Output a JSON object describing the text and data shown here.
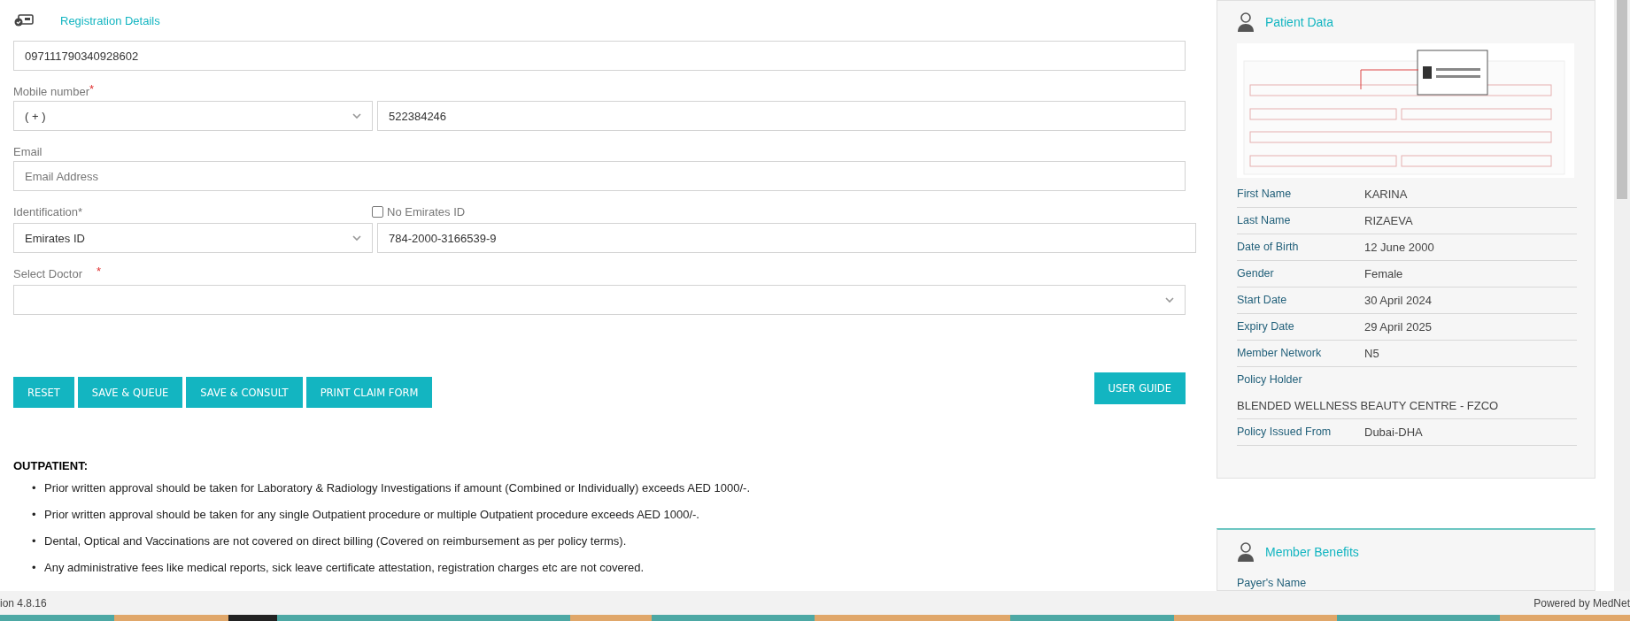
{
  "registration": {
    "title": "Registration Details",
    "card_number": {
      "value": "097111790340928602"
    },
    "mobile": {
      "label": "Mobile number",
      "required_mark": "*",
      "country_code": "( + )",
      "number": "522384246"
    },
    "email": {
      "label": "Email",
      "placeholder": "Email Address"
    },
    "identification": {
      "label": "Identification*",
      "no_id": {
        "label": "No Emirates ID",
        "checked": false
      },
      "type": "Emirates ID",
      "number": "784-2000-3166539-9"
    },
    "doctor": {
      "label": "Select Doctor",
      "required_mark": "*"
    }
  },
  "buttons": [
    {
      "label": "RESET"
    },
    {
      "label": "SAVE & QUEUE"
    },
    {
      "label": "SAVE & CONSULT"
    },
    {
      "label": "PRINT CLAIM FORM"
    }
  ],
  "user_guide": {
    "label": "USER GUIDE"
  },
  "notes": {
    "title": "OUTPATIENT:",
    "items": [
      {
        "marker": "•",
        "text": "Prior written approval should be taken for Laboratory & Radiology Investigations if amount (Combined or Individually) exceeds AED 1000/-."
      },
      {
        "marker": "•",
        "text": "Prior written approval should be taken for any single Outpatient procedure or multiple Outpatient procedure exceeds AED 1000/-."
      },
      {
        "marker": "•",
        "text": "Dental, Optical and Vaccinations are not covered on direct billing (Covered on reimbursement as per policy terms)."
      },
      {
        "marker": "•",
        "text": "Any administrative fees like medical reports, sick leave certificate attestation, registration charges etc are not covered."
      }
    ]
  },
  "patient_data": {
    "title": "Patient Data",
    "fields": [
      {
        "label": "First Name",
        "value": "KARINA"
      },
      {
        "label": "Last Name",
        "value": "RIZAEVA"
      },
      {
        "label": "Date of Birth",
        "value": "12 June 2000"
      },
      {
        "label": "Gender",
        "value": "Female"
      },
      {
        "label": "Start Date",
        "value": "30 April 2024"
      },
      {
        "label": "Expiry Date",
        "value": "29 April 2025"
      },
      {
        "label": "Member Network",
        "value": "N5"
      },
      {
        "label": "Policy Holder",
        "value": "BLENDED WELLNESS BEAUTY CENTRE - FZCO",
        "kind": "stacked"
      },
      {
        "label": "Policy Issued From",
        "value": "Dubai-DHA"
      }
    ]
  },
  "member_benefits": {
    "title": "Member Benefits",
    "first_label": "Payer's Name"
  },
  "footer": {
    "version": "ion 4.8.16",
    "powered": "Powered by MedNet"
  }
}
